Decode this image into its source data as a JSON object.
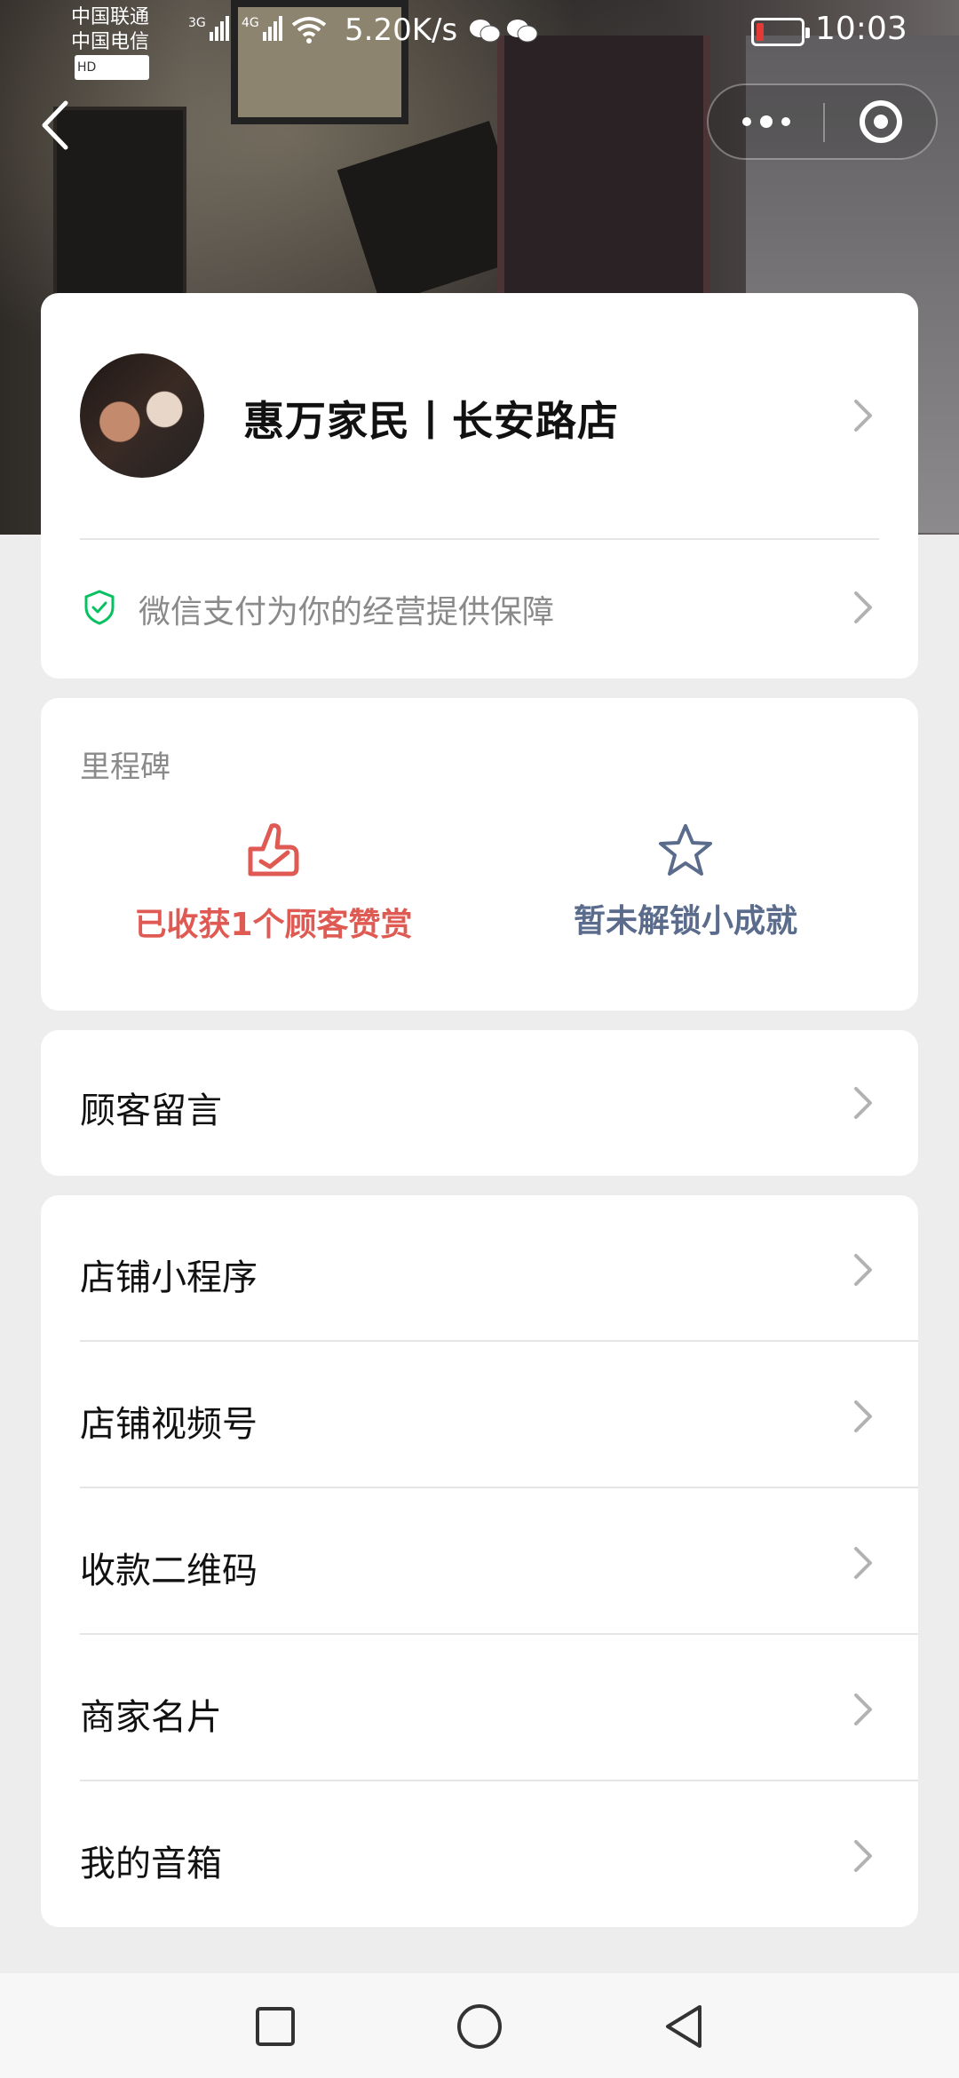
{
  "status_bar": {
    "carrier_1": "中国联通",
    "carrier_2": "中国电信",
    "hd_badge": "HD",
    "signal_1": "3G",
    "signal_2": "4G",
    "net_speed": "5.20K/s",
    "time": "10:03",
    "battery_color": "#e53935"
  },
  "store": {
    "name": "惠万家民丨长安路店",
    "guarantee_text": "微信支付为你的经营提供保障",
    "guarantee_icon_color": "#07c160"
  },
  "milestones": {
    "title": "里程碑",
    "items": [
      {
        "label": "已收获1个顾客赞赏",
        "icon": "thumbs-up-icon",
        "color": "#e05a54"
      },
      {
        "label": "暂未解锁小成就",
        "icon": "star-icon",
        "color": "#5a6b8c"
      }
    ]
  },
  "messages": {
    "label": "顾客留言"
  },
  "menu": {
    "items": [
      {
        "label": "店铺小程序"
      },
      {
        "label": "店铺视频号"
      },
      {
        "label": "收款二维码"
      },
      {
        "label": "商家名片"
      },
      {
        "label": "我的音箱"
      }
    ]
  }
}
